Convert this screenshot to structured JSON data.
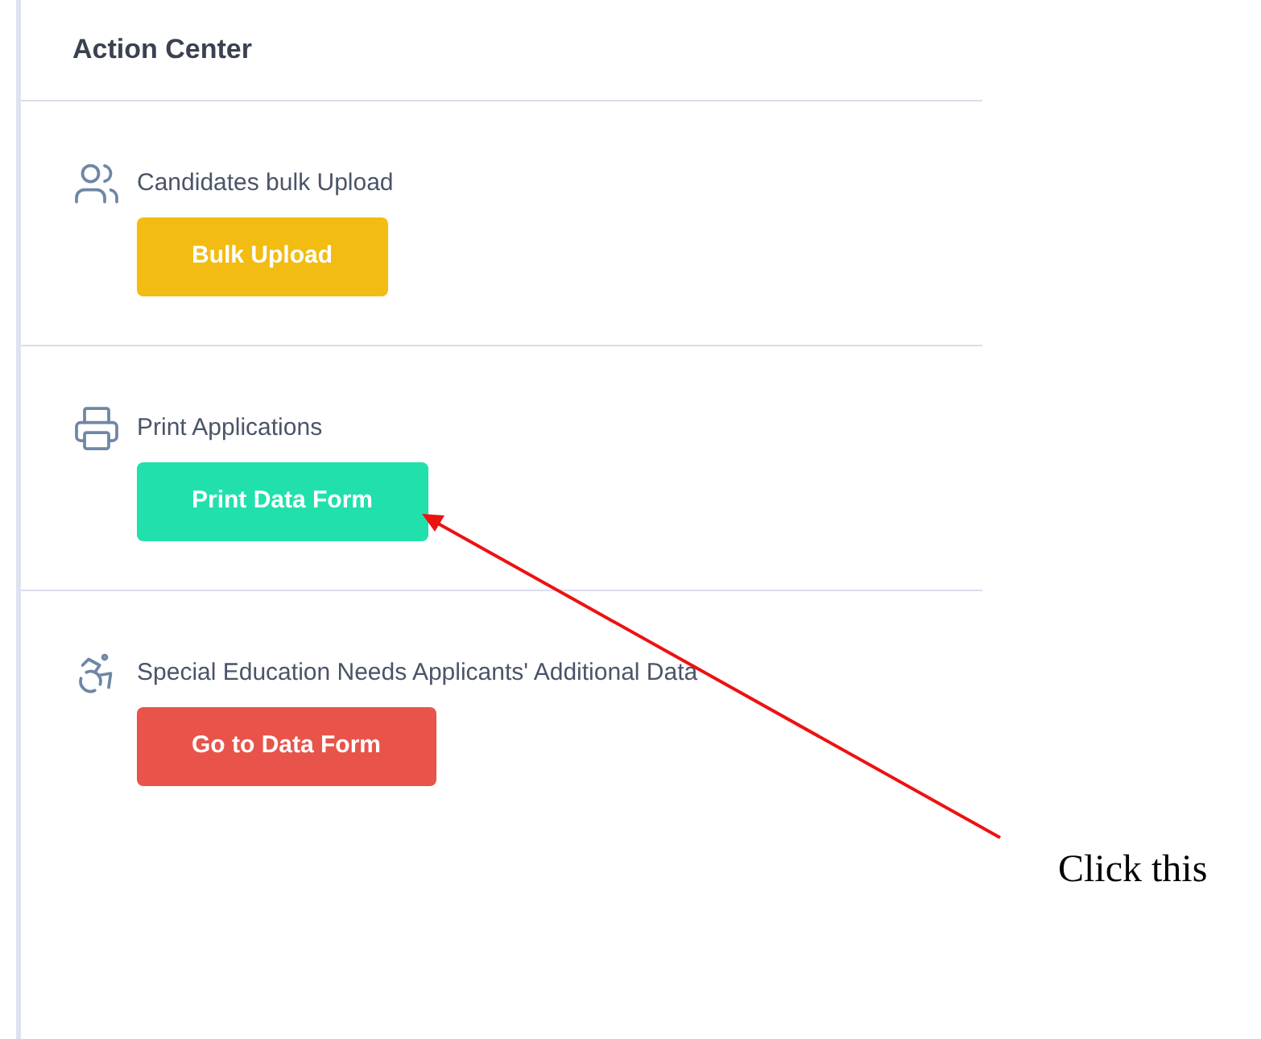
{
  "panel": {
    "title": "Action Center"
  },
  "sections": [
    {
      "kind": "people",
      "label": "Candidates bulk Upload",
      "button": "Bulk Upload",
      "color": "#f2bc12"
    },
    {
      "kind": "printer",
      "label": "Print Applications",
      "button": "Print Data Form",
      "color": "#21e0ac"
    },
    {
      "kind": "wheelchair",
      "label": "Special Education Needs Applicants' Additional Data",
      "button": "Go to Data Form",
      "color": "#e8544a"
    }
  ],
  "annotation": {
    "text": "Click this"
  }
}
